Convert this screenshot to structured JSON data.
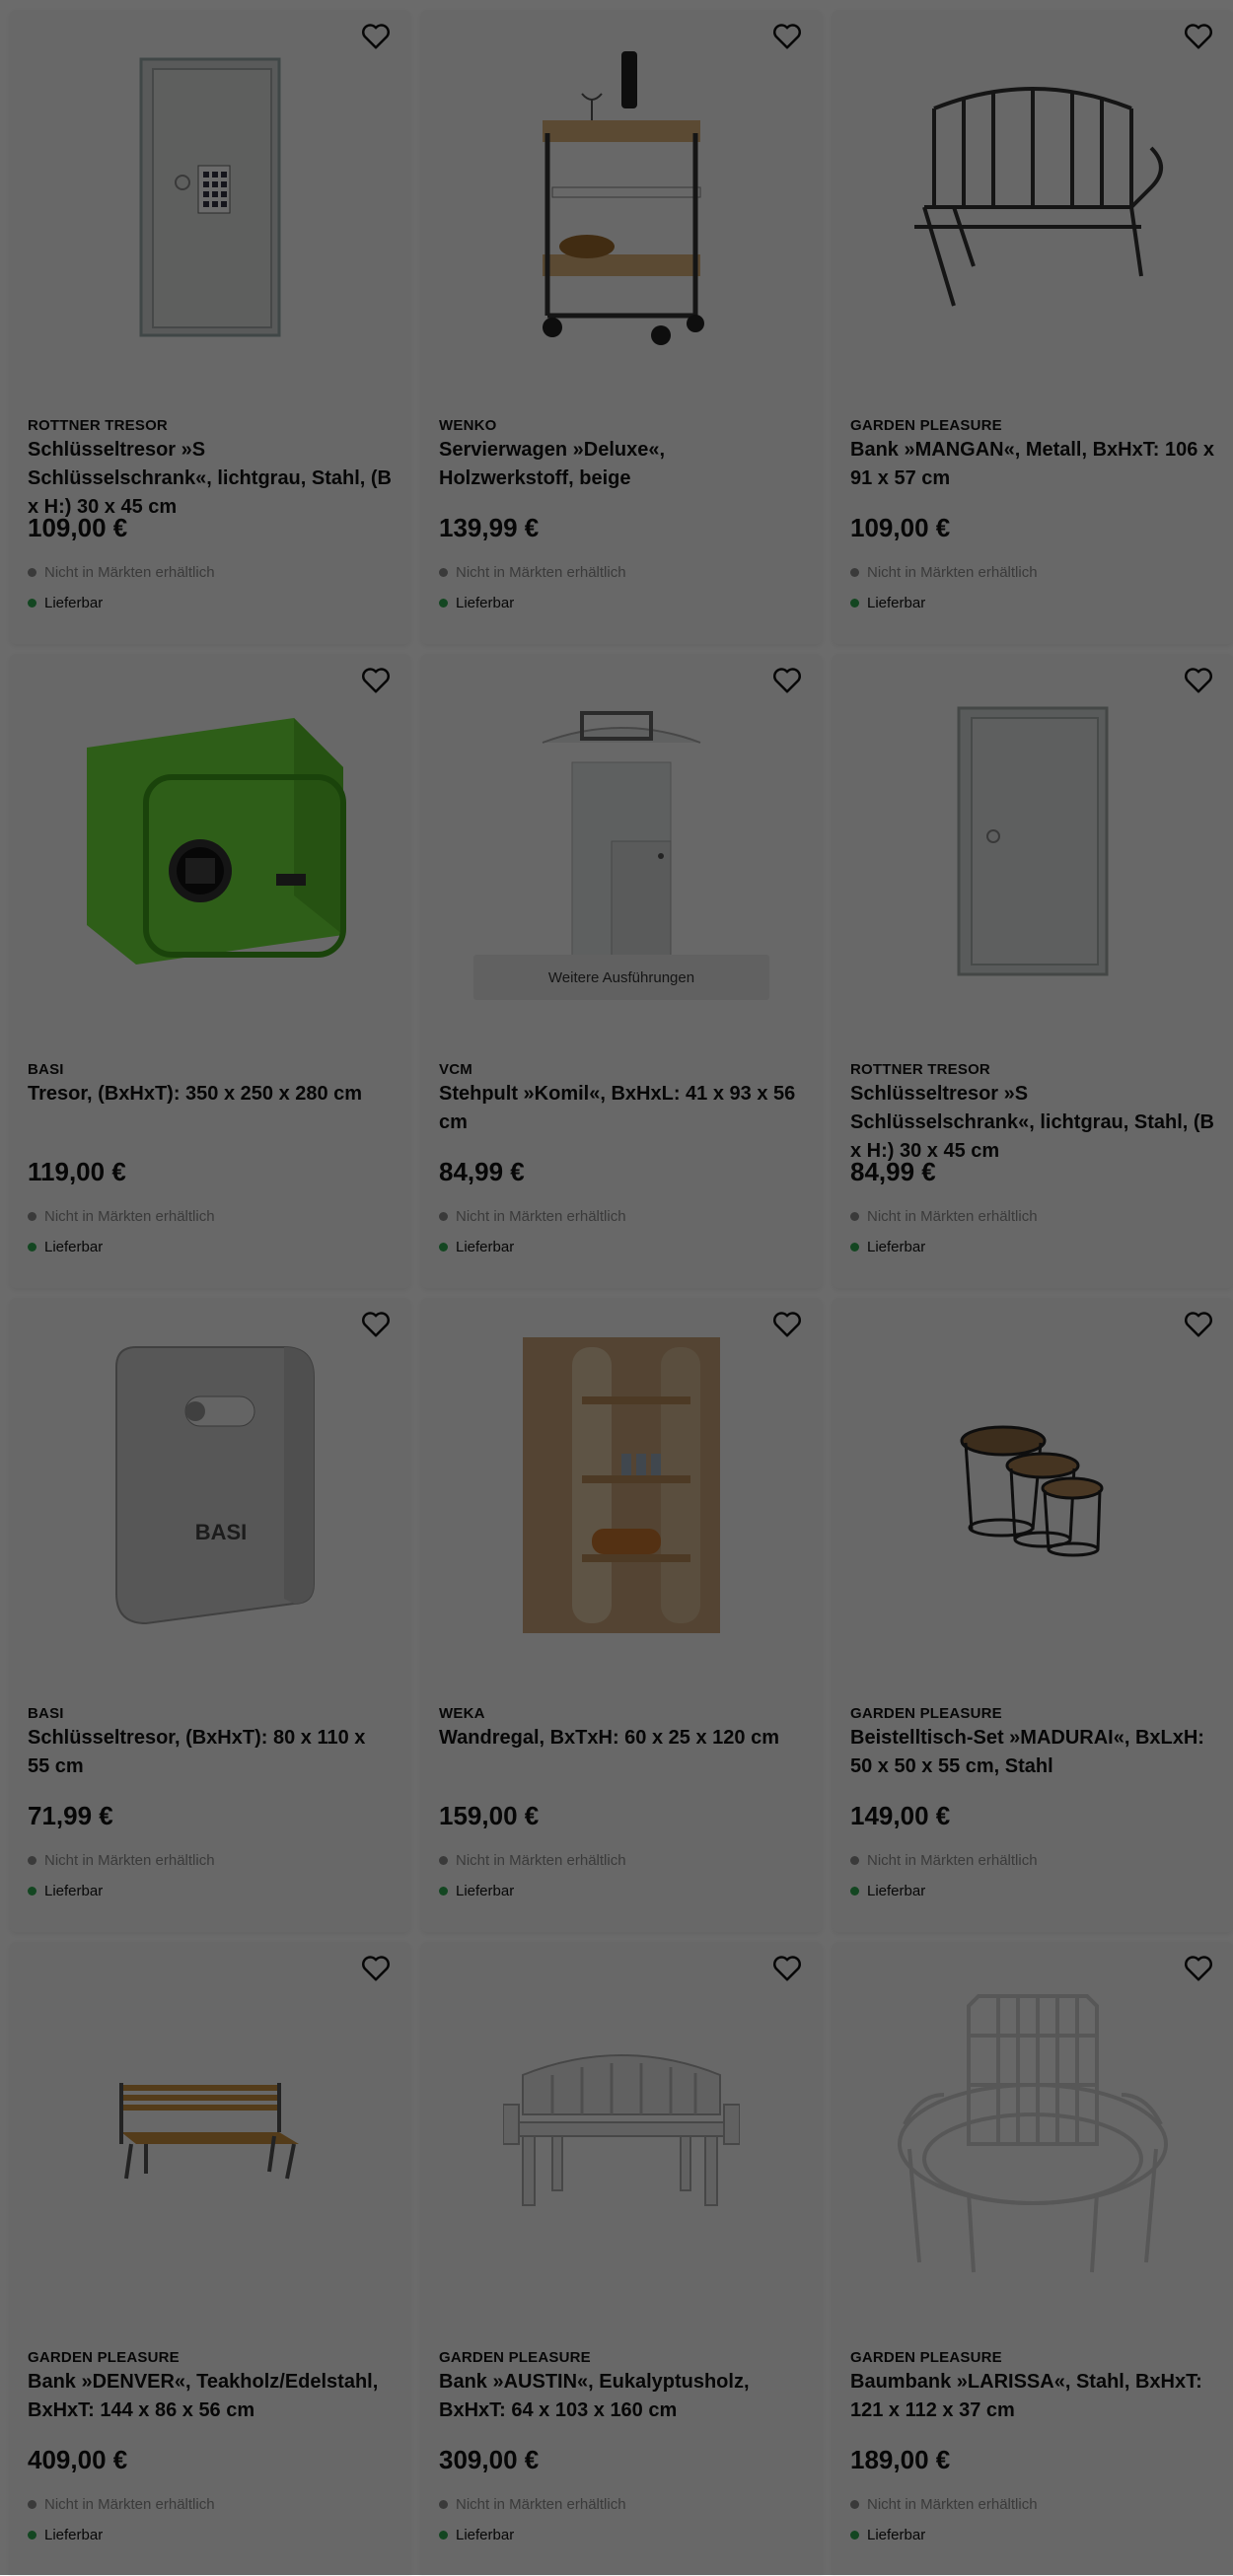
{
  "colors": {
    "unavailable_dot": "#8a8a8a",
    "available_dot": "#2fa84f"
  },
  "products": [
    {
      "brand": "ROTTNER TRESOR",
      "title": "Schlüsseltresor »S Schlüsselschrank«, lichtgrau, Stahl, (B x H:) 30 x 45 cm",
      "price": "109,00 €",
      "store": "Nicht in Märkten erhältlich",
      "delivery": "Lieferbar",
      "image": "key-cabinet-keypad"
    },
    {
      "brand": "WENKO",
      "title": "Servierwagen »Deluxe«, Holzwerkstoff, beige",
      "price": "139,99 €",
      "store": "Nicht in Märkten erhältlich",
      "delivery": "Lieferbar",
      "image": "serving-cart"
    },
    {
      "brand": "GARDEN PLEASURE",
      "title": "Bank »MANGAN«, Metall, BxHxT: 106 x 91 x 57 cm",
      "price": "109,00 €",
      "store": "Nicht in Märkten erhältlich",
      "delivery": "Lieferbar",
      "image": "metal-bench"
    },
    {
      "brand": "BASI",
      "title": "Tresor, (BxHxT): 350 x 250 x 280 cm",
      "price": "119,00 €",
      "store": "Nicht in Märkten erhältlich",
      "delivery": "Lieferbar",
      "image": "green-safe"
    },
    {
      "brand": "VCM",
      "title": "Stehpult »Komil«, BxHxL: 41 x 93 x 56 cm",
      "price": "84,99 €",
      "store": "Nicht in Märkten erhältlich",
      "delivery": "Lieferbar",
      "image": "standing-desk",
      "more_label": "Weitere Ausführungen"
    },
    {
      "brand": "ROTTNER TRESOR",
      "title": "Schlüsseltresor »S Schlüsselschrank«, lichtgrau, Stahl, (B x H:) 30 x 45 cm",
      "price": "84,99 €",
      "store": "Nicht in Märkten erhältlich",
      "delivery": "Lieferbar",
      "image": "key-cabinet-plain"
    },
    {
      "brand": "BASI",
      "title": "Schlüsseltresor, (BxHxT): 80 x 110 x 55 cm",
      "price": "71,99 €",
      "store": "Nicht in Märkten erhältlich",
      "delivery": "Lieferbar",
      "image": "grey-key-safe",
      "logo_text": "BASI"
    },
    {
      "brand": "WEKA",
      "title": "Wandregal, BxTxH: 60 x 25 x 120 cm",
      "price": "159,00 €",
      "store": "Nicht in Märkten erhältlich",
      "delivery": "Lieferbar",
      "image": "wall-shelf"
    },
    {
      "brand": "GARDEN PLEASURE",
      "title": "Beistelltisch-Set »MADURAI«, BxLxH: 50 x 50 x 55 cm, Stahl",
      "price": "149,00 €",
      "store": "Nicht in Märkten erhältlich",
      "delivery": "Lieferbar",
      "image": "side-tables"
    },
    {
      "brand": "GARDEN PLEASURE",
      "title": "Bank »DENVER«, Teakholz/Edelstahl, BxHxT: 144 x 86 x 56 cm",
      "price": "409,00 €",
      "store": "Nicht in Märkten erhältlich",
      "delivery": "Lieferbar",
      "image": "teak-bench"
    },
    {
      "brand": "GARDEN PLEASURE",
      "title": "Bank »AUSTIN«, Eukalyptusholz, BxHxT: 64 x 103 x 160 cm",
      "price": "309,00 €",
      "store": "Nicht in Märkten erhältlich",
      "delivery": "Lieferbar",
      "image": "white-bench"
    },
    {
      "brand": "GARDEN PLEASURE",
      "title": "Baumbank »LARISSA«, Stahl, BxHxT: 121 x 112 x 37 cm",
      "price": "189,00 €",
      "store": "Nicht in Märkten erhältlich",
      "delivery": "Lieferbar",
      "image": "tree-bench"
    }
  ]
}
